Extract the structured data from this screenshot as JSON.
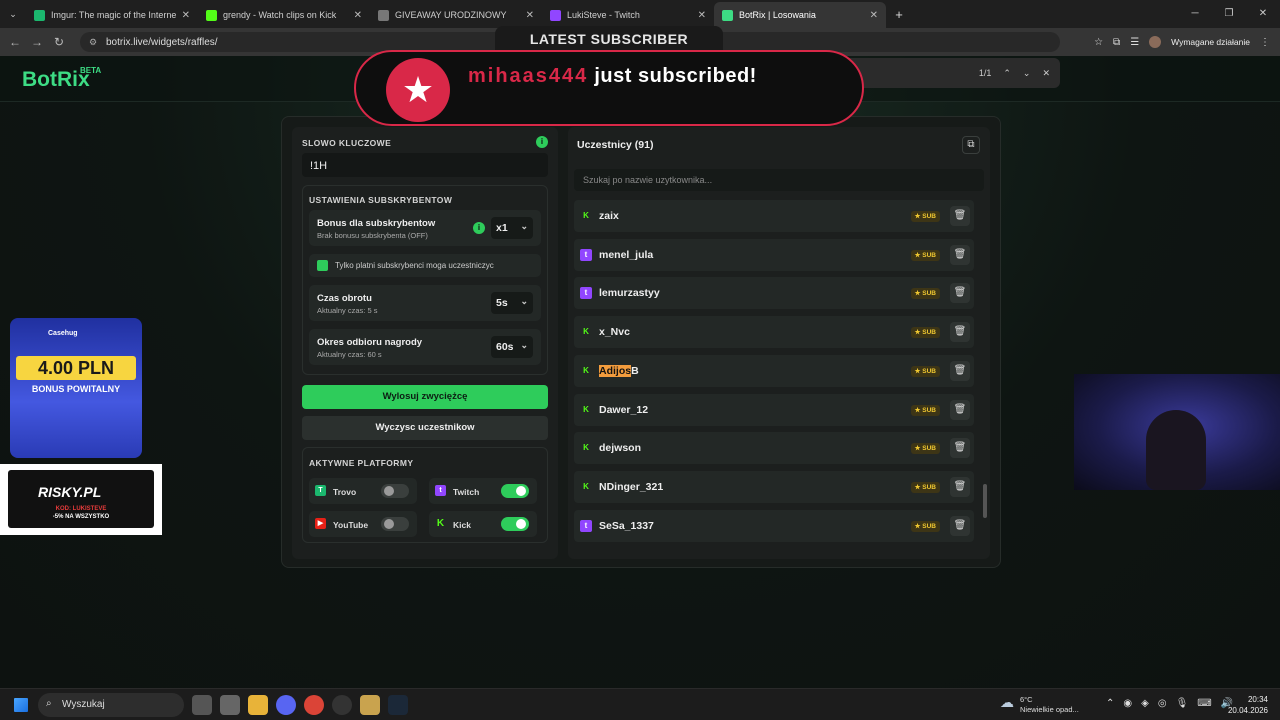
{
  "browser": {
    "tabs": [
      {
        "title": "Imgur: The magic of the Interne",
        "color": "#1bb76e",
        "active": false
      },
      {
        "title": "grendy - Watch clips on Kick",
        "color": "#53fc18",
        "active": false
      },
      {
        "title": "GIVEAWAY URODZINOWY",
        "color": "#777777",
        "active": false
      },
      {
        "title": "LukiSteve - Twitch",
        "color": "#9146ff",
        "active": false
      },
      {
        "title": "BotRix | Losowania",
        "color": "#3ddc84",
        "active": true
      }
    ],
    "url": "botrix.live/widgets/raffles/",
    "required_action": "Wymagane działanie",
    "find_count": "1/1"
  },
  "site": {
    "logo": "BotRix",
    "logo_sup": "BETA"
  },
  "raffle": {
    "keyword_label": "SLOWO KLUCZOWE",
    "keyword_value": "!1H",
    "sub_settings_label": "USTAWIENIA SUBSKRYBENTOW",
    "bonus_title": "Bonus dla subskrybentow",
    "bonus_sub": "Brak bonusu subskrybenta (OFF)",
    "bonus_value": "x1",
    "only_paid_label": "Tylko platni subskrybenci moga uczestniczyc",
    "spin_title": "Czas obrotu",
    "spin_sub": "Aktualny czas: 5 s",
    "spin_value": "5s",
    "claim_title": "Okres odbioru nagrody",
    "claim_sub": "Aktualny czas: 60 s",
    "claim_value": "60s",
    "draw_button": "Wylosuj zwyciężcę",
    "clear_button": "Wyczysc uczestnikow",
    "platforms_label": "AKTYWNE PLATFORMY",
    "platforms": [
      {
        "name": "Trovo",
        "enabled": false
      },
      {
        "name": "Twitch",
        "enabled": true
      },
      {
        "name": "YouTube",
        "enabled": false
      },
      {
        "name": "Kick",
        "enabled": true
      }
    ]
  },
  "participants": {
    "title": "Uczestnicy (91)",
    "search_placeholder": "Szukaj po nazwie uzytkownika...",
    "sub_badge": "SUB",
    "list": [
      {
        "name": "zaix",
        "platform": "kick"
      },
      {
        "name": "menel_jula",
        "platform": "twitch"
      },
      {
        "name": "lemurzastyy",
        "platform": "twitch"
      },
      {
        "name": "x_Nvc",
        "platform": "kick"
      },
      {
        "name": "AdijosB",
        "platform": "kick",
        "highlight": "Adijos",
        "rest": "B"
      },
      {
        "name": "Dawer_12",
        "platform": "kick"
      },
      {
        "name": "dejwson",
        "platform": "kick"
      },
      {
        "name": "NDinger_321",
        "platform": "kick"
      },
      {
        "name": "SeSa_1337",
        "platform": "twitch"
      }
    ]
  },
  "alert": {
    "header": "LATEST SUBSCRIBER",
    "username": "mihaas444",
    "message": "just subscribed!"
  },
  "promo": {
    "casino": "Casehug",
    "amount": "4.00 PLN",
    "bonus": "BONUS POWITALNY",
    "risky": "RISKY.PL",
    "code": "KOD: LUKISTEVE",
    "discount": "-5% NA WSZYSTKO"
  },
  "taskbar": {
    "search": "Wyszukaj",
    "temp": "6°C",
    "weather": "Niewielkie opad...",
    "time": "20:34",
    "date": "20.04.2026"
  }
}
